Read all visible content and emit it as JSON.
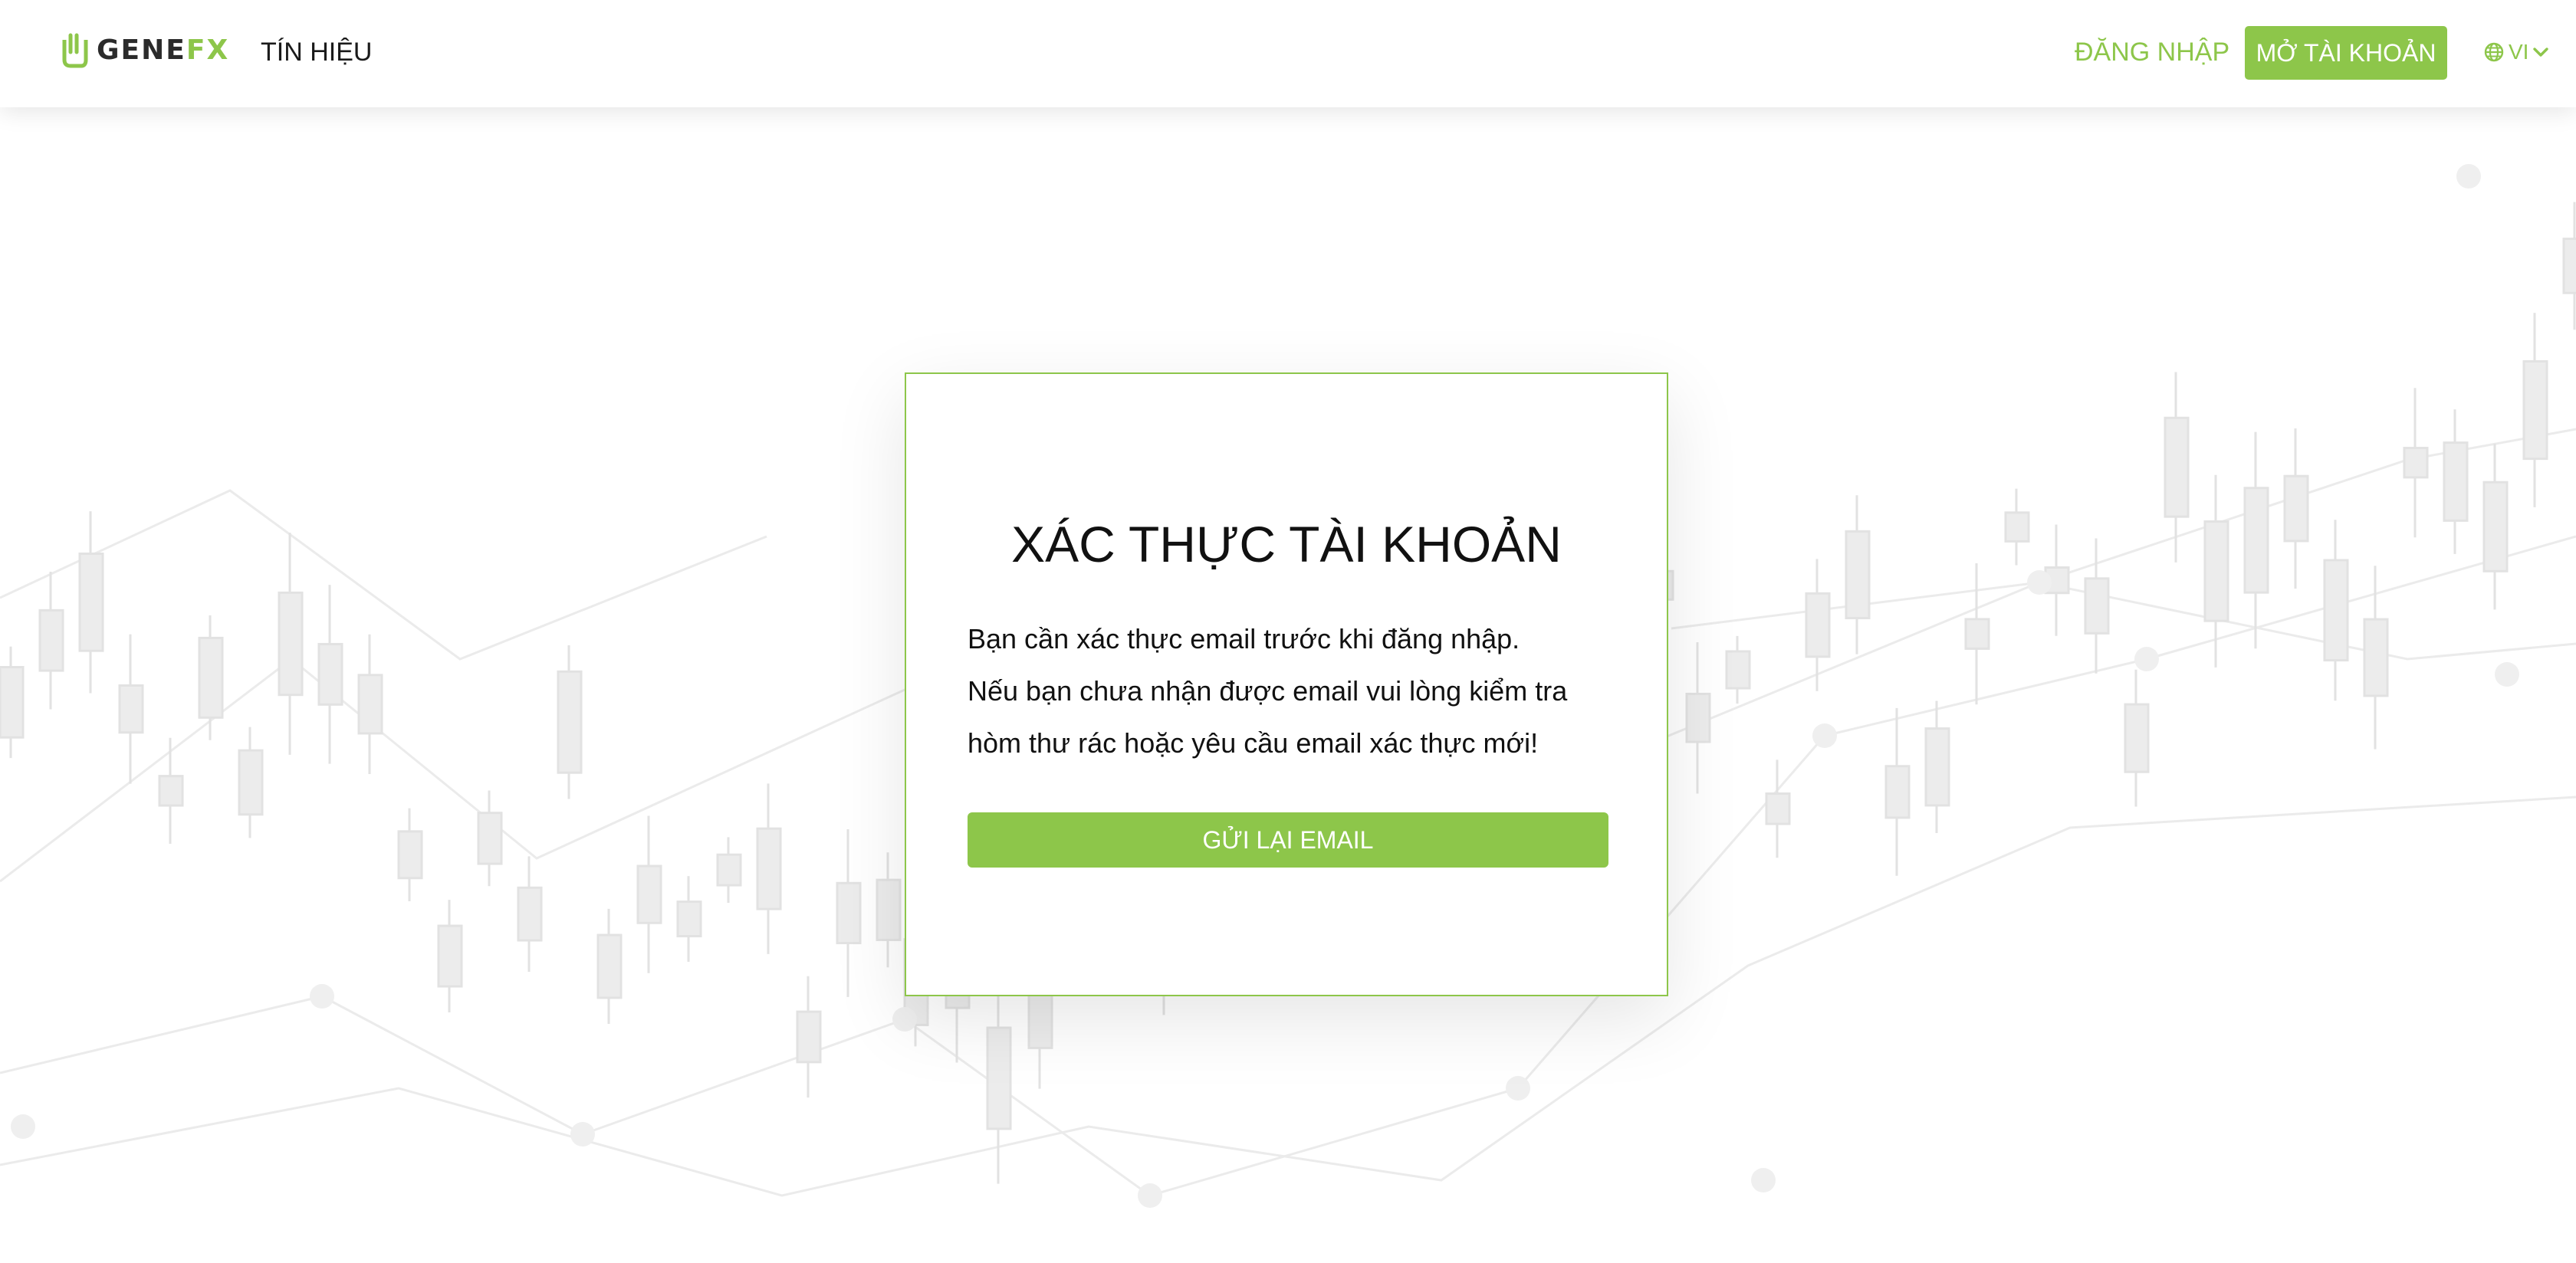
{
  "brand": {
    "name_part1": "GENE",
    "name_part2": "FX",
    "accent_color": "#8dc64a",
    "logo_icon": "genefx-hand-icon"
  },
  "nav": {
    "signals": "TÍN HIỆU",
    "login": "ĐĂNG NHẬP",
    "open_account": "MỞ TÀI KHOẢN",
    "language": "VI",
    "language_icons": [
      "globe-icon",
      "chevron-down-icon"
    ]
  },
  "verify": {
    "title": "XÁC THỰC TÀI KHOẢN",
    "line1": "Bạn cần xác thực email trước khi đăng nhập.",
    "line2": "Nếu bạn chưa nhận được email vui lòng kiểm tra hòm thư rác hoặc yêu cầu email xác thực mới!",
    "resend_button": "GỬI LẠI EMAIL"
  },
  "background": {
    "description_icon": "candlestick-chart-pattern",
    "color": "#e6e6e6"
  }
}
